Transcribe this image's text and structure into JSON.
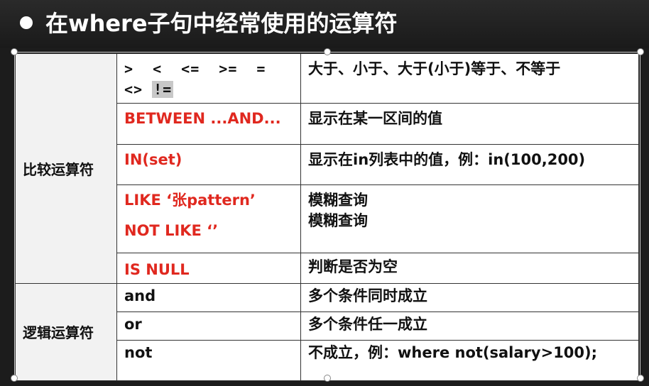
{
  "slide": {
    "title": "在where子句中经常使用的运算符"
  },
  "table": {
    "comparison": {
      "category": "比较运算符",
      "rows": [
        {
          "op_line1": "> < <= >= =",
          "op_line2": "<> ",
          "op_highlight": "!=",
          "desc": "大于、小于、大于(小于)等于、不等于"
        },
        {
          "op": "BETWEEN  ...AND...",
          "desc": "显示在某一区间的值"
        },
        {
          "op": "IN(set)",
          "desc": "显示在in列表中的值，例：in(100,200)"
        },
        {
          "op_line1": "LIKE ‘张pattern’",
          "op_line2": "NOT LIKE  ‘’",
          "desc_line1": "模糊查询",
          "desc_line2": "模糊查询"
        },
        {
          "op": "IS NULL",
          "desc": "判断是否为空"
        }
      ]
    },
    "logical": {
      "category": "逻辑运算符",
      "rows": [
        {
          "op": "and",
          "desc": "多个条件同时成立"
        },
        {
          "op": "or",
          "desc": "多个条件任一成立"
        },
        {
          "op": "not",
          "desc": "不成立，例：where not(salary>100);"
        }
      ]
    }
  },
  "colors": {
    "keyword_red": "#e0281f",
    "background": "#1c1c1c"
  }
}
